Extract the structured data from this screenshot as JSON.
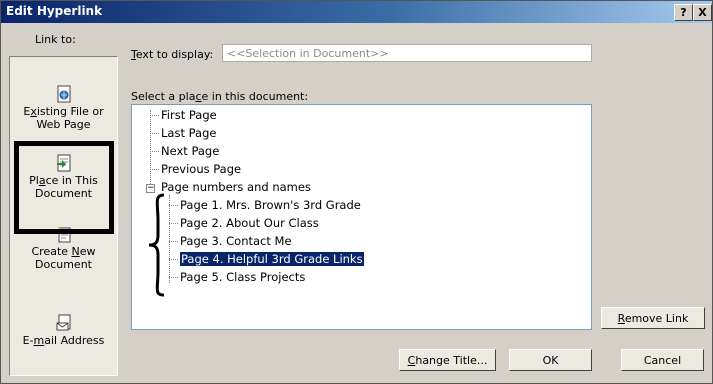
{
  "window": {
    "title": "Edit Hyperlink",
    "help_label": "?",
    "close_label": "X"
  },
  "sidebar": {
    "heading": "Link to:",
    "items": [
      {
        "label_pre": "E",
        "label_key": "x",
        "label_post": "isting File or",
        "label_line2": "Web Page",
        "icon": "file-web-icon"
      },
      {
        "label_pre": "Pl",
        "label_key": "a",
        "label_post": "ce in This",
        "label_line2": "Document",
        "icon": "place-in-document-icon",
        "selected": true
      },
      {
        "label_pre": "Create ",
        "label_key": "N",
        "label_post": "ew",
        "label_line2": "Document",
        "icon": "new-document-icon"
      },
      {
        "label_pre": "E-",
        "label_key": "m",
        "label_post": "ail Address",
        "label_line2": "",
        "icon": "email-icon"
      }
    ]
  },
  "text_to_display": {
    "label_key": "T",
    "label_rest": "ext to display:",
    "value": "<<Selection in Document>>"
  },
  "place_select": {
    "label_pre": "Select a pla",
    "label_key": "c",
    "label_post": "e in this document:"
  },
  "tree": {
    "top_items": [
      "First Page",
      "Last Page",
      "Next Page",
      "Previous Page"
    ],
    "group_label": "Page numbers and names",
    "group_expander": "−",
    "pages": [
      "Page 1. Mrs. Brown's 3rd Grade",
      "Page 2. About Our Class",
      "Page 3. Contact Me",
      "Page 4. Helpful 3rd Grade Links",
      "Page 5. Class Projects"
    ],
    "selected_index": 3
  },
  "buttons": {
    "remove_link_key": "R",
    "remove_link_rest": "emove Link",
    "change_title_key": "C",
    "change_title_rest": "hange Title...",
    "ok": "OK",
    "cancel": "Cancel"
  },
  "colors": {
    "titlebar": "#0a246a",
    "selection": "#0a246a",
    "dialog_bg": "#d4d0c8"
  }
}
